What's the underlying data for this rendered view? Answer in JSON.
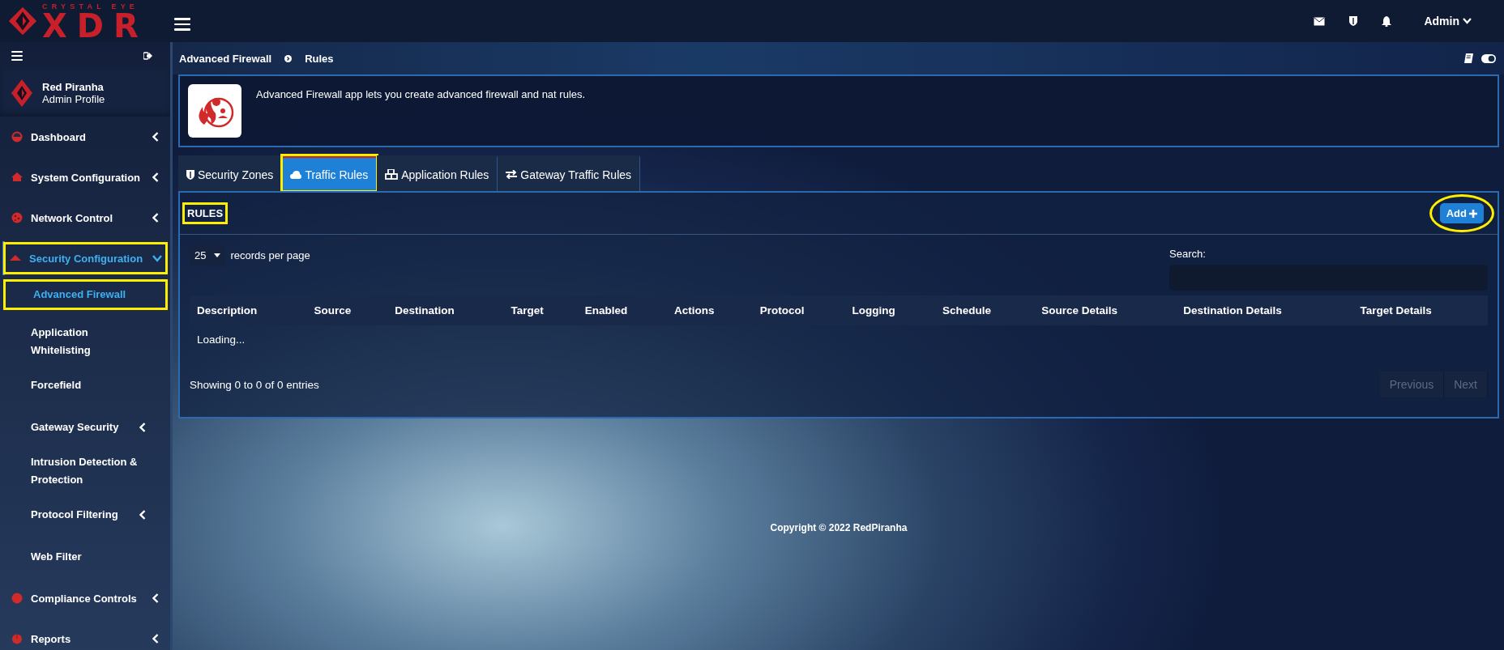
{
  "brand": {
    "tagline": "CRYSTAL EYE",
    "name": "XDR"
  },
  "topbar": {
    "user": "Admin"
  },
  "sidebar": {
    "profile": {
      "name": "Red Piranha",
      "role": "Admin Profile"
    },
    "items": [
      {
        "label": "Dashboard",
        "selected": false,
        "expanded": false,
        "highlighted": false
      },
      {
        "label": "System Configuration",
        "selected": false,
        "expanded": false,
        "highlighted": false
      },
      {
        "label": "Network Control",
        "selected": false,
        "expanded": false,
        "highlighted": false
      },
      {
        "label": "Security Configuration",
        "selected": true,
        "expanded": true,
        "highlighted": true,
        "children": [
          {
            "label": "Advanced Firewall",
            "selected": true,
            "highlighted": true
          },
          {
            "label": "Application Whitelisting",
            "selected": false,
            "highlighted": false
          },
          {
            "label": "Forcefield",
            "selected": false,
            "highlighted": false
          },
          {
            "label": "Gateway Security",
            "selected": false,
            "expanded": false,
            "highlighted": false
          },
          {
            "label": "Intrusion Detection & Protection",
            "selected": false,
            "highlighted": false
          },
          {
            "label": "Protocol Filtering",
            "selected": false,
            "expanded": false,
            "highlighted": false
          },
          {
            "label": "Web Filter",
            "selected": false,
            "highlighted": false
          }
        ]
      },
      {
        "label": "Compliance Controls",
        "selected": false,
        "expanded": false,
        "highlighted": false
      },
      {
        "label": "Reports",
        "selected": false,
        "expanded": false,
        "highlighted": false
      }
    ]
  },
  "breadcrumb": [
    {
      "label": "Advanced Firewall"
    },
    {
      "label": "Rules"
    }
  ],
  "info": {
    "text": "Advanced Firewall app lets you create advanced firewall and nat rules."
  },
  "tabs": [
    {
      "label": "Security Zones",
      "selected": false,
      "highlighted": false
    },
    {
      "label": "Traffic Rules",
      "selected": true,
      "highlighted": true
    },
    {
      "label": "Application Rules",
      "selected": false,
      "highlighted": false
    },
    {
      "label": "Gateway Traffic Rules",
      "selected": false,
      "highlighted": false
    }
  ],
  "rules_panel": {
    "title": "RULES",
    "title_highlighted": true,
    "add_button": {
      "label": "Add",
      "highlighted": true
    },
    "page_length": "25",
    "page_length_label": "records per page",
    "search_label": "Search:",
    "columns": [
      "Description",
      "Source",
      "Destination",
      "Target",
      "Enabled",
      "Actions",
      "Protocol",
      "Logging",
      "Schedule",
      "Source Details",
      "Destination Details",
      "Target Details"
    ],
    "rows": [
      {
        "message": "Loading..."
      }
    ],
    "info": "Showing 0 to 0 of 0 entries",
    "pagination": [
      {
        "label": "Previous",
        "disabled": true
      },
      {
        "label": "Next",
        "disabled": true
      }
    ]
  },
  "footer": "Copyright © 2022 RedPiranha"
}
